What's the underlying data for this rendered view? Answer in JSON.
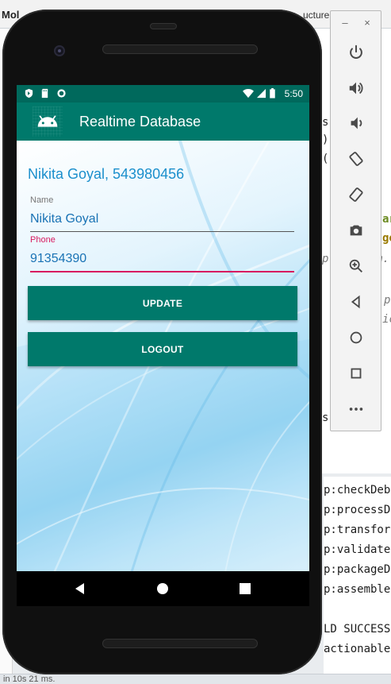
{
  "ide": {
    "title": "Mol",
    "structure_tab": "ucture",
    "code_fragments": [
      "s",
      ")",
      "(",
      "ar",
      "go",
      "p",
      "m.",
      "p",
      "ic",
      "s"
    ],
    "console_lines": [
      "p:checkDeb",
      "p:processD",
      "p:transfor",
      "p:validate",
      "p:packageD",
      "p:assemble",
      "",
      "LD SUCCESS",
      "actionable"
    ],
    "bottom_text": "in 10s 21 ms."
  },
  "emulator_toolbar": {
    "minimize_label": "–",
    "close_label": "×",
    "buttons": [
      "power-icon",
      "volume-up-icon",
      "volume-down-icon",
      "rotate-left-icon",
      "rotate-right-icon",
      "camera-icon",
      "zoom-icon",
      "back-icon",
      "home-icon",
      "overview-icon",
      "more-icon"
    ]
  },
  "device": {
    "status_bar": {
      "time": "5:50"
    },
    "app_bar": {
      "title": "Realtime Database"
    },
    "profile": {
      "greeting": "Nikita Goyal, 543980456",
      "name_label": "Name",
      "name_value": "Nikita Goyal",
      "phone_label": "Phone",
      "phone_value": "91354390"
    },
    "buttons": {
      "update": "UPDATE",
      "logout": "LOGOUT"
    }
  },
  "colors": {
    "primary": "#00796b",
    "primary_dark": "#00695c",
    "accent": "#d81b60",
    "text_blue": "#1b8fcc"
  }
}
